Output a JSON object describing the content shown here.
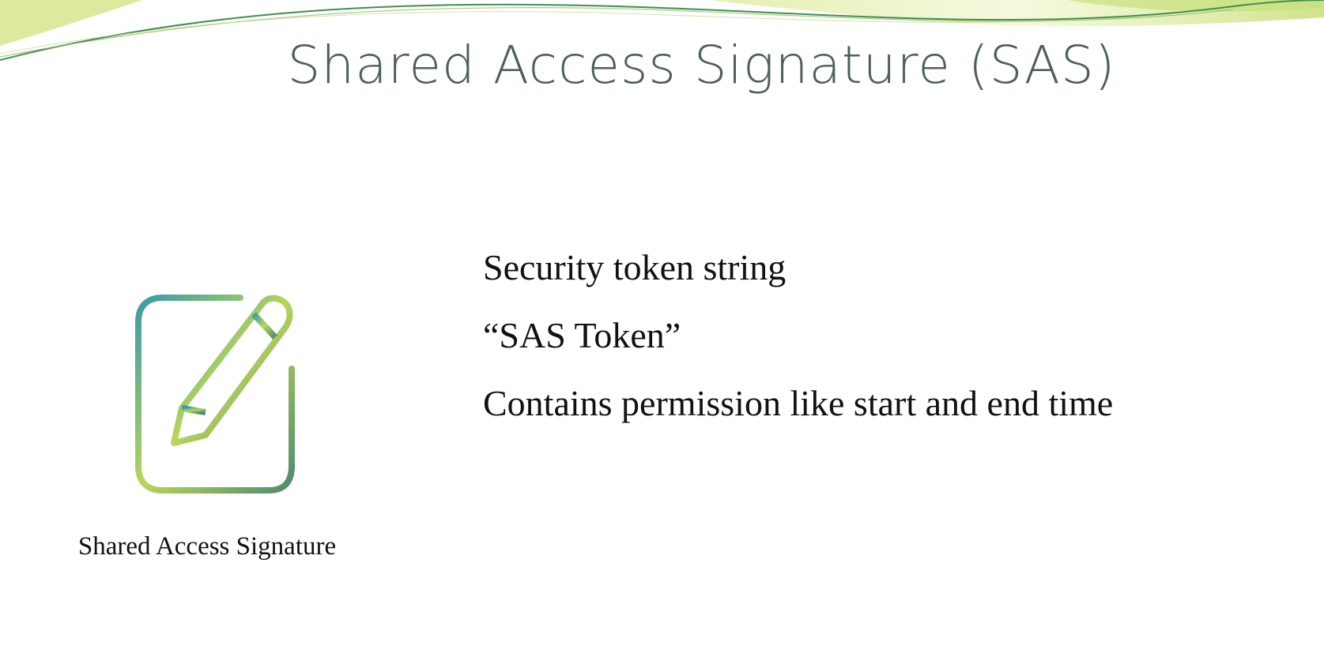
{
  "slide": {
    "title": "Shared Access Signature (SAS)",
    "icon": {
      "name": "edit-document-icon",
      "caption": "Shared Access Signature"
    },
    "bullets": [
      "Security token string",
      "“SAS Token”",
      "Contains permission like start and end time"
    ]
  },
  "colors": {
    "title": "#4d5f58",
    "body_text": "#111111",
    "icon_gradient_start": "#3a9aa8",
    "icon_gradient_mid": "#b9d65a",
    "icon_gradient_end": "#4f8a6e",
    "swoosh_light": "#d9e89a",
    "swoosh_line": "#3f8f4e"
  }
}
